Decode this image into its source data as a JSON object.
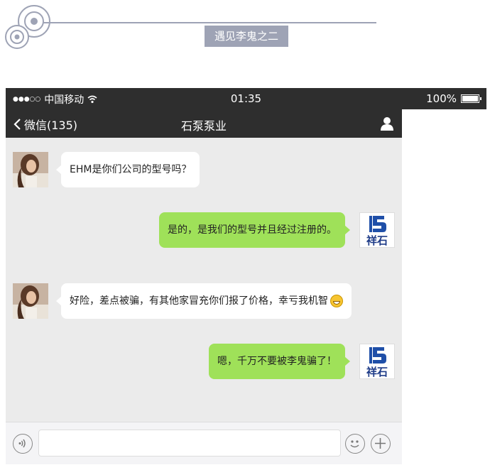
{
  "header": {
    "title": "遇见李鬼之二",
    "accent_color": "#9ea3b5"
  },
  "status_bar": {
    "carrier": "中国移动",
    "time": "01:35",
    "battery": "100%",
    "signal_icon": "signal-dots-icon",
    "wifi_icon": "wifi-icon"
  },
  "nav": {
    "back_label": "微信(135)",
    "title": "石泵泵业",
    "contact_icon": "person-icon"
  },
  "messages": [
    {
      "side": "in",
      "text": "EHM是你们公司的型号吗？",
      "avatar": "girl-avatar"
    },
    {
      "side": "out",
      "text": "是的，是我们的型号并且经过注册的。",
      "avatar": "xiangshi-logo"
    },
    {
      "side": "in",
      "text": "好险，差点被骗，有其他家冒充你们报了价格，幸亏我机智",
      "avatar": "girl-avatar",
      "emoji": "grin-emoji"
    },
    {
      "side": "out",
      "text": "嗯，千万不要被李鬼骗了！",
      "avatar": "xiangshi-logo"
    }
  ],
  "logo": {
    "text": "祥石",
    "color": "#1f4fa8"
  },
  "input_bar": {
    "voice_icon": "voice-icon",
    "emoji_icon": "smiley-icon",
    "plus_icon": "plus-icon"
  },
  "colors": {
    "bar_bg": "#2e2e2e",
    "chat_bg": "#ebebeb",
    "bubble_out": "#9fe159",
    "bubble_in": "#ffffff"
  }
}
